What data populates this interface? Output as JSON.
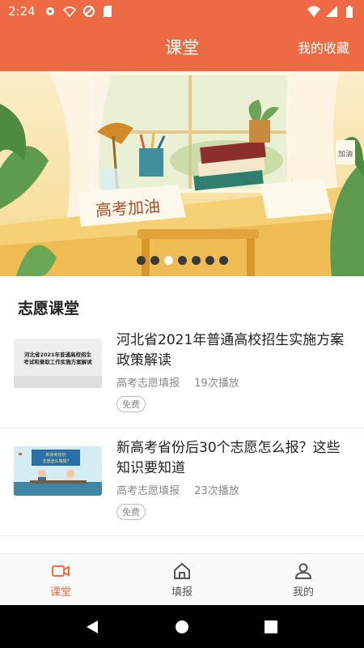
{
  "status_bar": {
    "time": "2:24"
  },
  "header": {
    "title": "课堂",
    "favorites_label": "我的收藏"
  },
  "banner": {
    "slide_count": 7,
    "active_index": 2,
    "text": "高考加油",
    "note_text": "加油"
  },
  "section": {
    "title": "志愿课堂"
  },
  "courses": [
    {
      "title": "河北省2021年普通高校招生实施方案政策解读",
      "thumb_text_line1": "河北省2021年普通高校招生",
      "thumb_text_line2": "考试和录取工作实施方案解读",
      "category": "高考志愿填报",
      "plays": "19次播放",
      "badge": "免费"
    },
    {
      "title": "新高考省份后30个志愿怎么报？这些知识要知道",
      "thumb_text_line1": "新高考省份",
      "thumb_text_line2": "志愿怎么填报?",
      "category": "高考志愿填报",
      "plays": "23次播放",
      "badge": "免费"
    }
  ],
  "nav": {
    "items": [
      {
        "label": "课堂",
        "icon": "video-camera-icon"
      },
      {
        "label": "填报",
        "icon": "home-icon"
      },
      {
        "label": "我的",
        "icon": "person-icon"
      }
    ],
    "active_index": 0
  },
  "colors": {
    "brand": "#ee6a45",
    "nav_inactive": "#555555"
  }
}
